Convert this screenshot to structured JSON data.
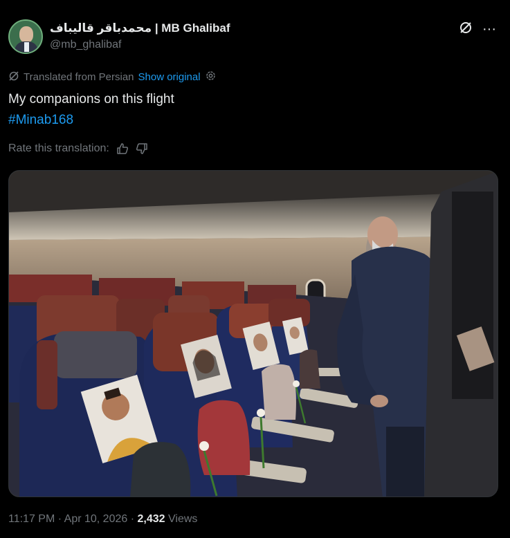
{
  "author": {
    "display_name": "محمدباقر قالیباف | MB Ghalibaf",
    "handle": "@mb_ghalibaf"
  },
  "header_icons": [
    "grok-icon",
    "more-icon"
  ],
  "more_label": "···",
  "translation": {
    "notice": "Translated from Persian",
    "show_original": "Show original"
  },
  "tweet": {
    "text": "My companions on this flight",
    "hashtag": "#Minab168"
  },
  "rate": {
    "label": "Rate this translation:"
  },
  "meta": {
    "time": "11:17 PM",
    "date": "Apr 10, 2026",
    "views_count": "2,432",
    "views_label": "Views"
  },
  "colors": {
    "link": "#1d9bf0",
    "muted": "#71767b",
    "text": "#e7e9ea",
    "background": "#000000"
  }
}
